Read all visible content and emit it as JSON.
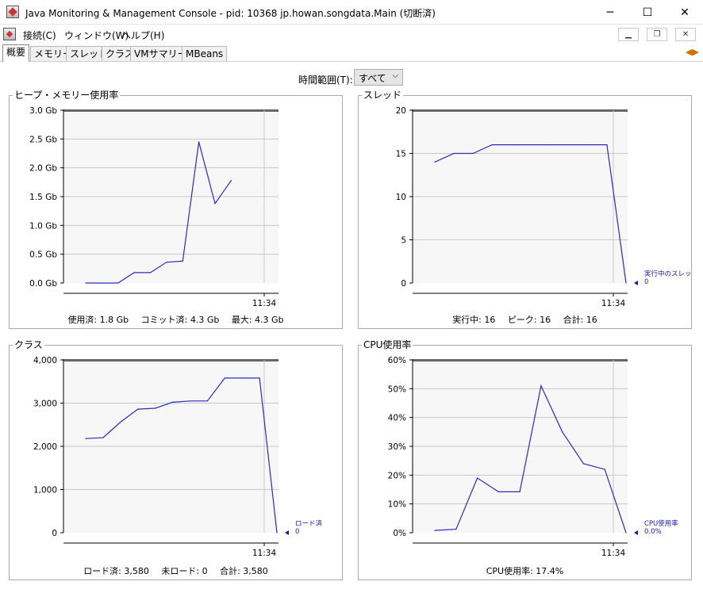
{
  "window": {
    "title": "Java Monitoring & Management Console - pid: 10368 jp.howan.songdata.Main (切断済)",
    "minimize": "─",
    "maximize": "☐",
    "close": "✕"
  },
  "menu": {
    "items": [
      "接続(C)",
      "ウィンドウ(W)",
      "ヘルプ(H)"
    ],
    "mdi_minimize": "▁",
    "mdi_restore": "❐",
    "mdi_close": "✕"
  },
  "tabs": [
    "概要",
    "メモリー",
    "スレッド",
    "クラス",
    "VMサマリー",
    "MBeans"
  ],
  "time_range": {
    "label": "時間範囲(T):",
    "value": "すべて"
  },
  "chart_data": [
    {
      "id": "heap",
      "type": "line",
      "title": "ヒープ・メモリー使用率",
      "y_ticks": [
        "3.0 Gb",
        "2.5 Gb",
        "2.0 Gb",
        "1.5 Gb",
        "1.0 Gb",
        "0.5 Gb",
        "0.0 Gb"
      ],
      "ylim": [
        0,
        3.0
      ],
      "x_tick": "11:34",
      "series": [
        {
          "values": [
            0.0,
            0.0,
            0.0,
            0.18,
            0.18,
            0.36,
            0.38,
            2.45,
            1.38,
            1.78
          ]
        }
      ],
      "summary": [
        "使用済: 1.8 Gb",
        "コミット済: 4.3 Gb",
        "最大: 4.3 Gb"
      ]
    },
    {
      "id": "threads",
      "type": "line",
      "title": "スレッド",
      "y_ticks": [
        "20",
        "15",
        "10",
        "5",
        "0"
      ],
      "ylim": [
        0,
        20
      ],
      "x_tick": "11:34",
      "series": [
        {
          "name": "実行中のスレッド",
          "current": "0",
          "values": [
            14,
            15,
            15,
            16,
            16,
            16,
            16,
            16,
            16,
            16,
            0
          ]
        }
      ],
      "summary": [
        "実行中: 16",
        "ピーク: 16",
        "合計: 16"
      ]
    },
    {
      "id": "classes",
      "type": "line",
      "title": "クラス",
      "y_ticks": [
        "4,000",
        "3,000",
        "2,000",
        "1,000",
        "0"
      ],
      "ylim": [
        0,
        4000
      ],
      "x_tick": "11:34",
      "series": [
        {
          "name": "ロード済",
          "current": "0",
          "values": [
            2180,
            2200,
            2560,
            2860,
            2880,
            3020,
            3050,
            3050,
            3580,
            3580,
            3580,
            0
          ]
        }
      ],
      "summary": [
        "ロード済: 3,580",
        "未ロード: 0",
        "合計: 3,580"
      ]
    },
    {
      "id": "cpu",
      "type": "line",
      "title": "CPU使用率",
      "y_ticks": [
        "60%",
        "50%",
        "40%",
        "30%",
        "20%",
        "10%",
        "0%"
      ],
      "ylim": [
        0,
        60
      ],
      "x_tick": "11:34",
      "series": [
        {
          "name": "CPU使用率",
          "current": "0.0%",
          "values": [
            0.8,
            1.2,
            19,
            14.2,
            14.2,
            51,
            35,
            24,
            22,
            0
          ]
        }
      ],
      "summary": [
        "CPU使用率: 17.4%"
      ]
    }
  ],
  "colors": {
    "line": "#2b2bbf",
    "plot_bg": "#f7f7f7",
    "grid": "#c8c8c8",
    "legend": "#1a1aa6"
  }
}
